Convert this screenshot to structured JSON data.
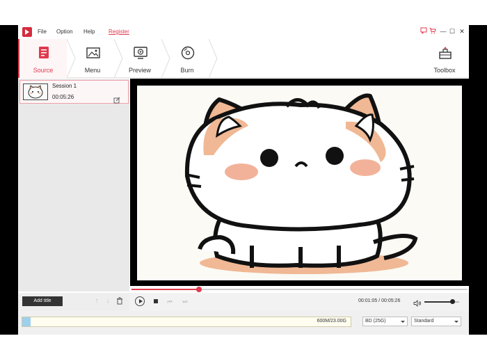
{
  "menu": {
    "file": "File",
    "option": "Option",
    "help": "Help",
    "register": "Register"
  },
  "window_controls": {
    "feedback_icon": "feedback-icon",
    "cart_icon": "cart-icon",
    "minimize": "—",
    "maximize": "☐",
    "close": "✕"
  },
  "toolbar": {
    "steps": [
      {
        "label": "Source",
        "icon": "source-icon",
        "active": true
      },
      {
        "label": "Menu",
        "icon": "menu-image-icon",
        "active": false
      },
      {
        "label": "Preview",
        "icon": "preview-icon",
        "active": false
      },
      {
        "label": "Burn",
        "icon": "disc-icon",
        "active": false
      }
    ],
    "toolbox": {
      "label": "Toolbox",
      "icon": "toolbox-icon"
    }
  },
  "sessions": [
    {
      "title": "Session 1",
      "duration": "00:05:26"
    }
  ],
  "controls": {
    "add_title": "Add title",
    "time": "00:01:05 / 00:05:26",
    "progress": 0.2,
    "volume": 0.8
  },
  "bottom": {
    "capacity_text": "600M/23.00G",
    "capacity_fill": 0.025,
    "disc_type": "BD (25G)",
    "quality": "Standard"
  },
  "colors": {
    "accent": "#e03a4d",
    "capacity_fill": "#9ed0ec"
  }
}
